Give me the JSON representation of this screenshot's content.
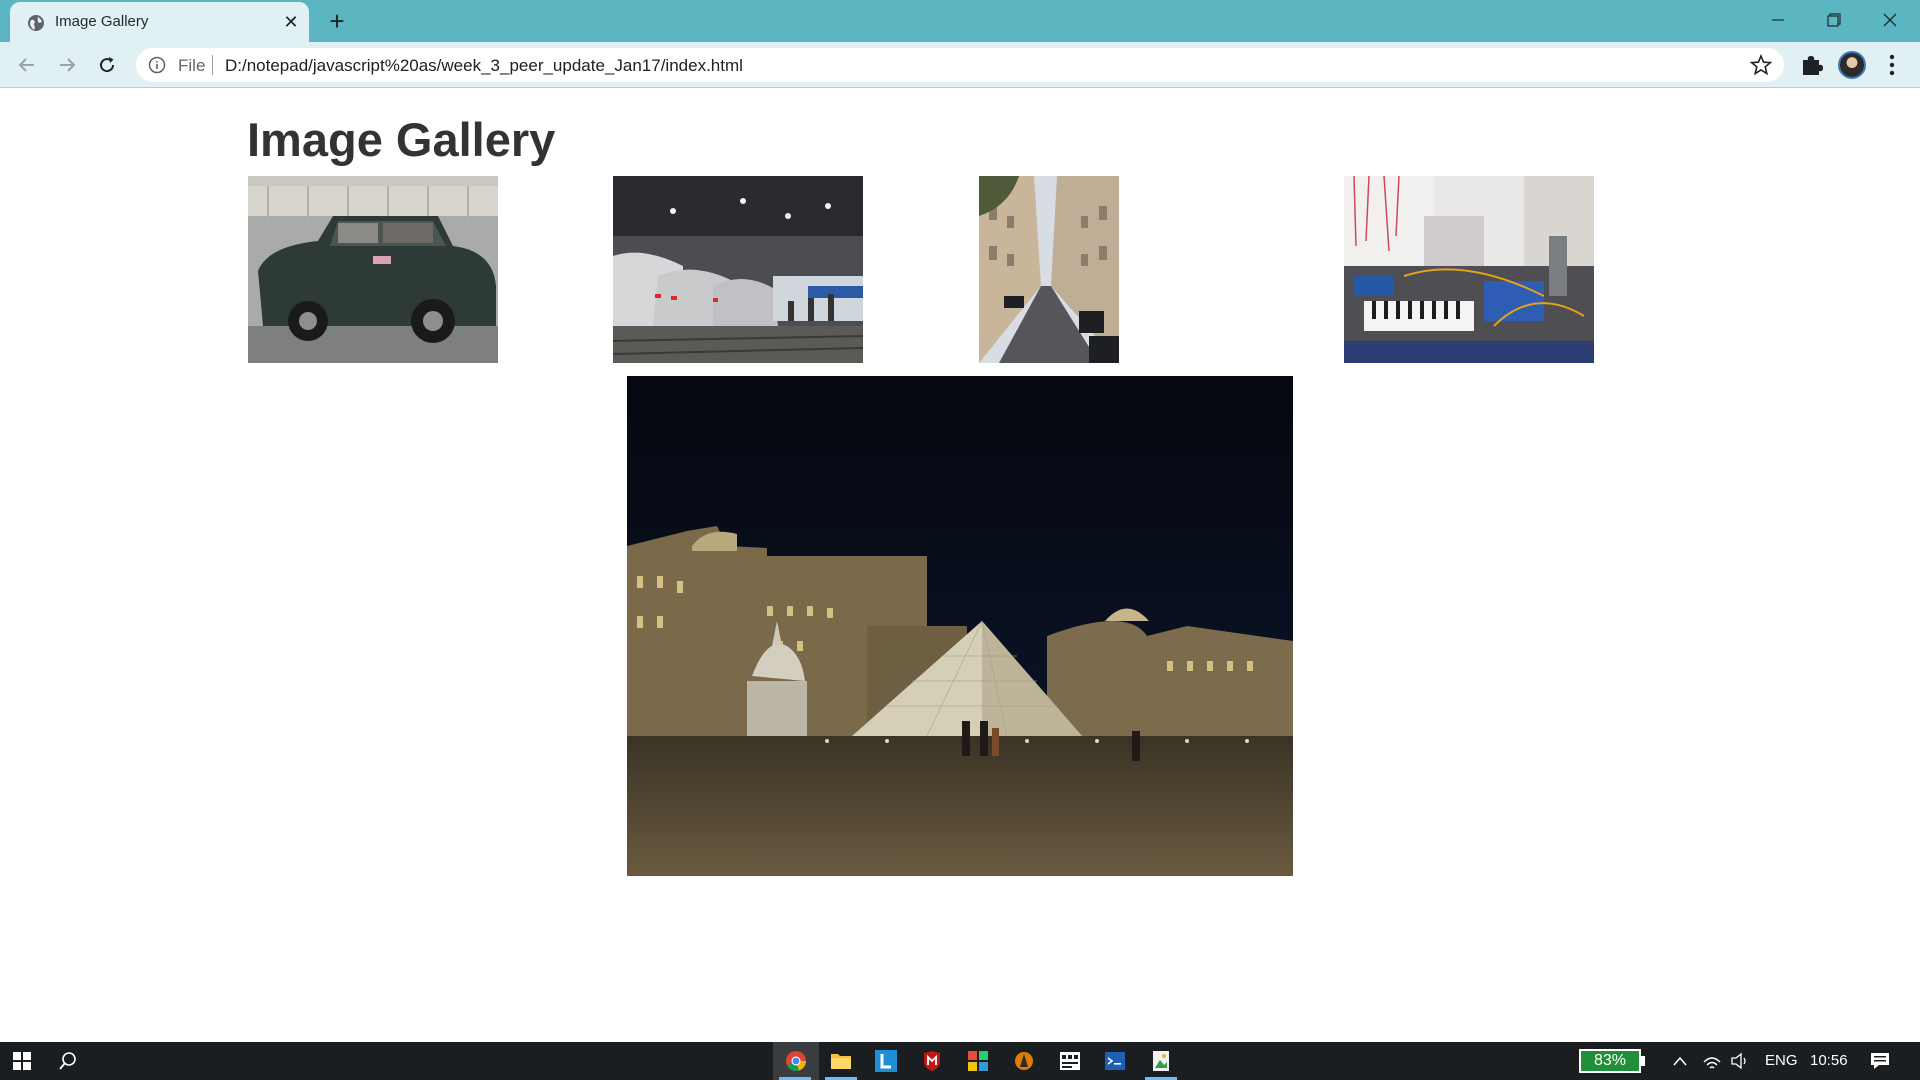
{
  "browser": {
    "tab_title": "Image Gallery",
    "new_tab_symbol": "+",
    "close_tab_symbol": "✕",
    "address_scheme_label": "File",
    "url": "D:/notepad/javascript%20as/week_3_peer_update_Jan17/index.html",
    "icons": [
      "globe-icon",
      "back-arrow-icon",
      "forward-arrow-icon",
      "reload-icon",
      "info-icon",
      "star-icon",
      "puzzle-icon",
      "avatar",
      "menu-icon",
      "minimize-icon",
      "restore-icon",
      "close-window-icon"
    ]
  },
  "page": {
    "title": "Image Gallery",
    "thumbnails": [
      {
        "subject": "green mini car parked on street"
      },
      {
        "subject": "high-speed trains at station platform"
      },
      {
        "subject": "narrow Paris street with parked cars"
      },
      {
        "subject": "synthesizer workshop with cables"
      }
    ],
    "main_image": {
      "subject": "Louvre pyramid at night"
    }
  },
  "taskbar": {
    "battery_percent": "83%",
    "language": "ENG",
    "time": "10:56",
    "icons": [
      "windows-start-icon",
      "search-icon",
      "chrome-icon",
      "file-explorer-icon",
      "l-app-icon",
      "mcafee-icon",
      "office-icon",
      "vlc-icon",
      "sticky-app-icon",
      "terminal-icon",
      "image-app-icon",
      "chevron-up-icon",
      "wifi-icon",
      "speaker-icon",
      "notification-icon"
    ],
    "colors": {
      "background": "#1b1e20",
      "battery": "#1f8f3a",
      "active_underline": "#76b9ed"
    }
  },
  "colors": {
    "titlebar": "#5bb6c2",
    "toolbar": "#e0f0f3",
    "page_title_text": "#333333"
  }
}
